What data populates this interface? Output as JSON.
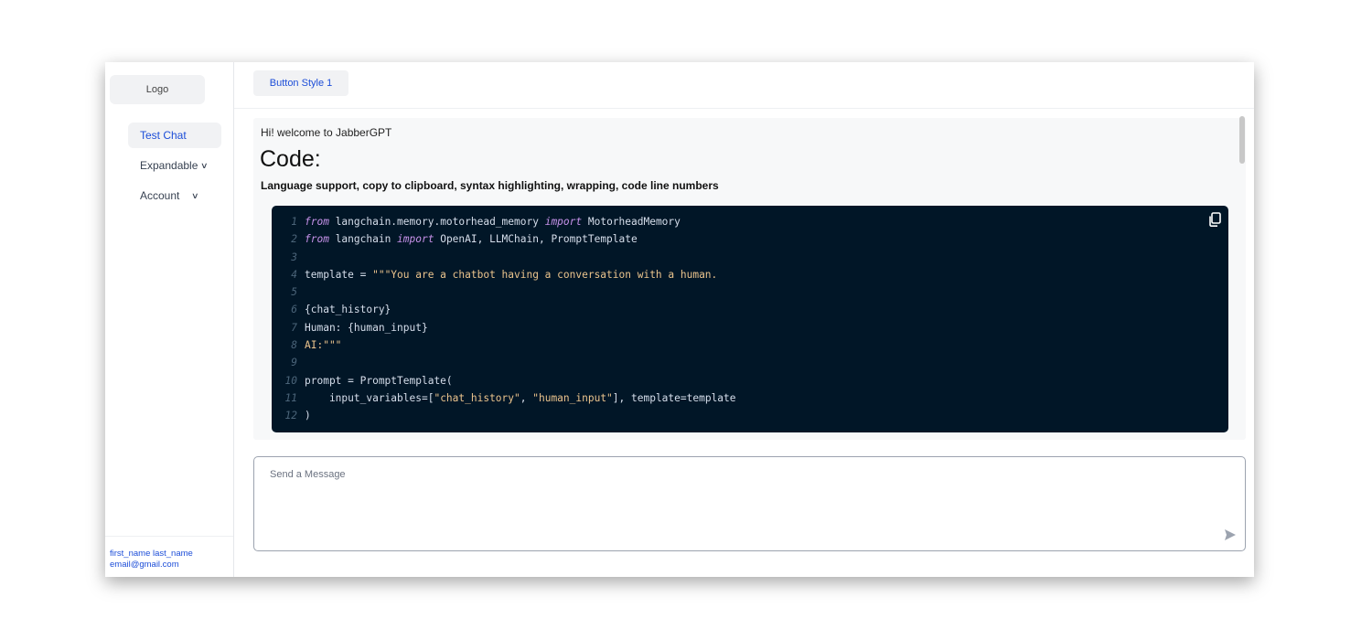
{
  "sidebar": {
    "logo": "Logo",
    "items": [
      {
        "label": "Test Chat",
        "active": true
      },
      {
        "label": "Expandable",
        "icon": "chevron-down-icon"
      },
      {
        "label": "Account",
        "icon": "chevron-down-icon"
      }
    ],
    "user": {
      "name": "first_name last_name",
      "email": "email@gmail.com"
    }
  },
  "topbar": {
    "button_label": "Button Style 1"
  },
  "chat": {
    "welcome": "Hi! welcome to JabberGPT",
    "heading": "Code:",
    "subheading": "Language support, copy to clipboard, syntax highlighting, wrapping, code line numbers",
    "code": {
      "copy_icon": "copy-icon",
      "lines": [
        {
          "n": "1",
          "html": "<span class=\"kw\">from</span> langchain.memory.motorhead_memory <span class=\"kw\">import</span> MotorheadMemory"
        },
        {
          "n": "2",
          "html": "<span class=\"kw\">from</span> langchain <span class=\"kw\">import</span> OpenAI, LLMChain, PromptTemplate"
        },
        {
          "n": "3",
          "html": ""
        },
        {
          "n": "4",
          "html": "template = <span class=\"str\">\"\"\"You are a chatbot having a conversation with a human.</span>"
        },
        {
          "n": "5",
          "html": ""
        },
        {
          "n": "6",
          "html": "{chat_history}"
        },
        {
          "n": "7",
          "html": "Human: {human_input}"
        },
        {
          "n": "8",
          "html": "<span class=\"str\">AI:\"\"\"</span>"
        },
        {
          "n": "9",
          "html": ""
        },
        {
          "n": "10",
          "html": "prompt = PromptTemplate("
        },
        {
          "n": "11",
          "html": "    input_variables=[<span class=\"str\">\"chat_history\"</span>, <span class=\"str\">\"human_input\"</span>], template=template"
        },
        {
          "n": "12",
          "html": ")"
        }
      ]
    }
  },
  "composer": {
    "placeholder": "Send a Message",
    "send_icon": "send-icon"
  }
}
